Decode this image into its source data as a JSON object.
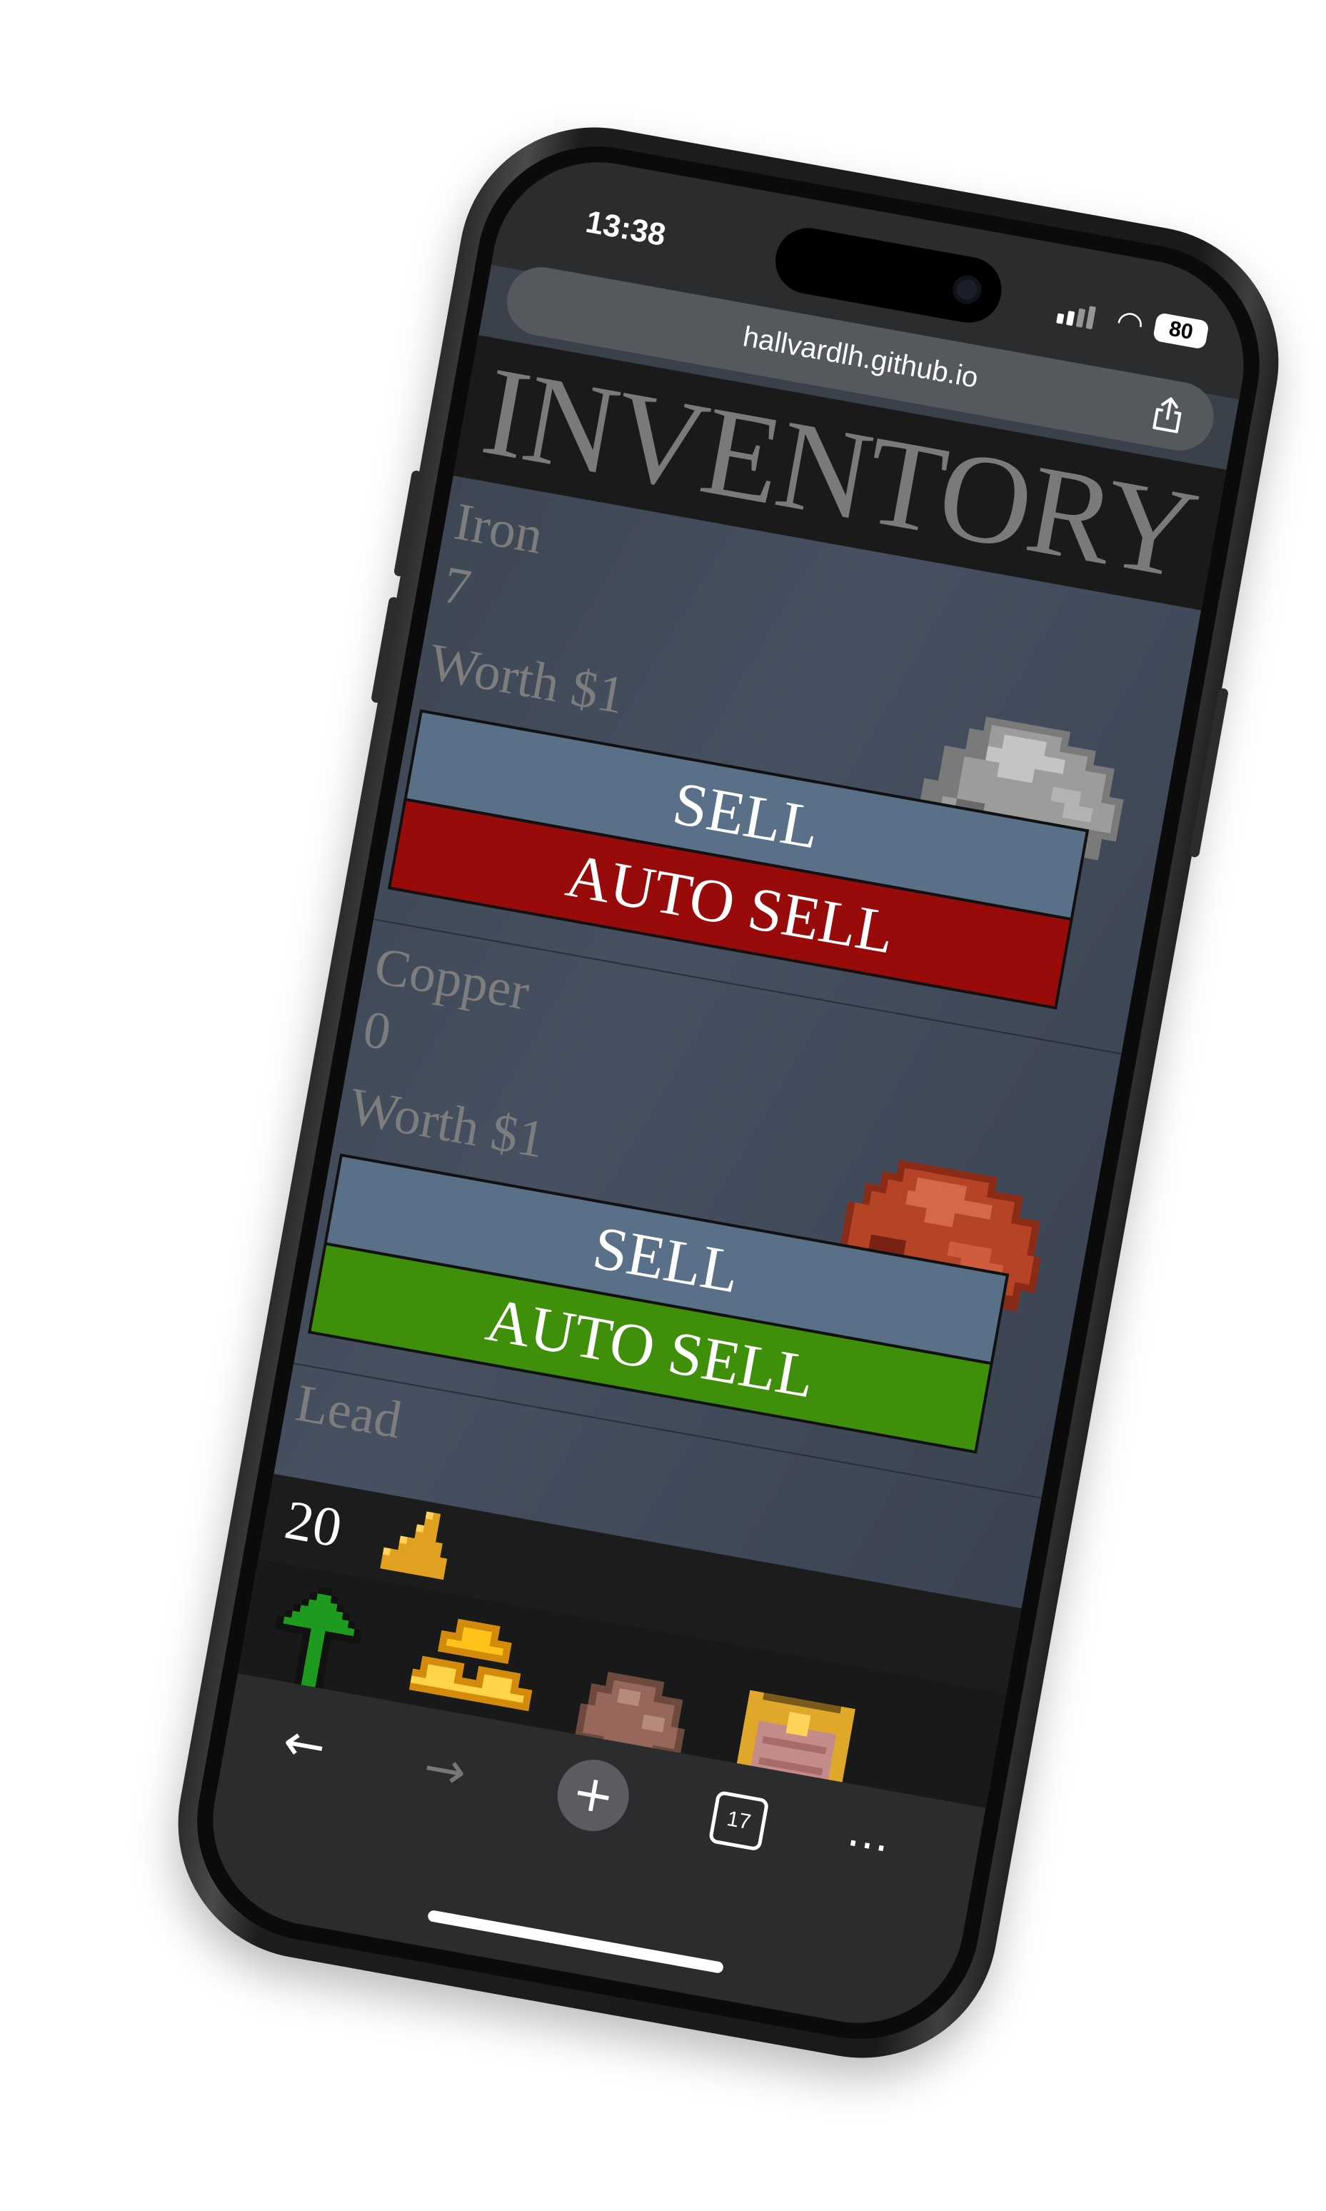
{
  "status": {
    "time": "13:38",
    "battery": "80"
  },
  "browser": {
    "url": "hallvardlh.github.io",
    "tab_count": "17"
  },
  "page": {
    "title": "INVENTORY"
  },
  "items": [
    {
      "name": "Iron",
      "count": "7",
      "worth": "Worth $1",
      "sell_label": "SELL",
      "auto_label": "AUTO SELL",
      "auto_color": "#990b0b",
      "ore": "iron-ore-icon"
    },
    {
      "name": "Copper",
      "count": "0",
      "worth": "Worth $1",
      "sell_label": "SELL",
      "auto_label": "AUTO SELL",
      "auto_color": "#3f8f0b",
      "ore": "copper-ore-icon"
    }
  ],
  "partial_item": {
    "name": "Lead"
  },
  "wallet": {
    "money": "20"
  },
  "game_nav": [
    "upgrade-arrow-icon",
    "gold-bars-icon",
    "ore-icon",
    "treasure-chest-icon"
  ],
  "colors": {
    "page_bg": "#414a58",
    "header_bg": "#1a1a1a",
    "sell_btn": "#5a7088"
  }
}
